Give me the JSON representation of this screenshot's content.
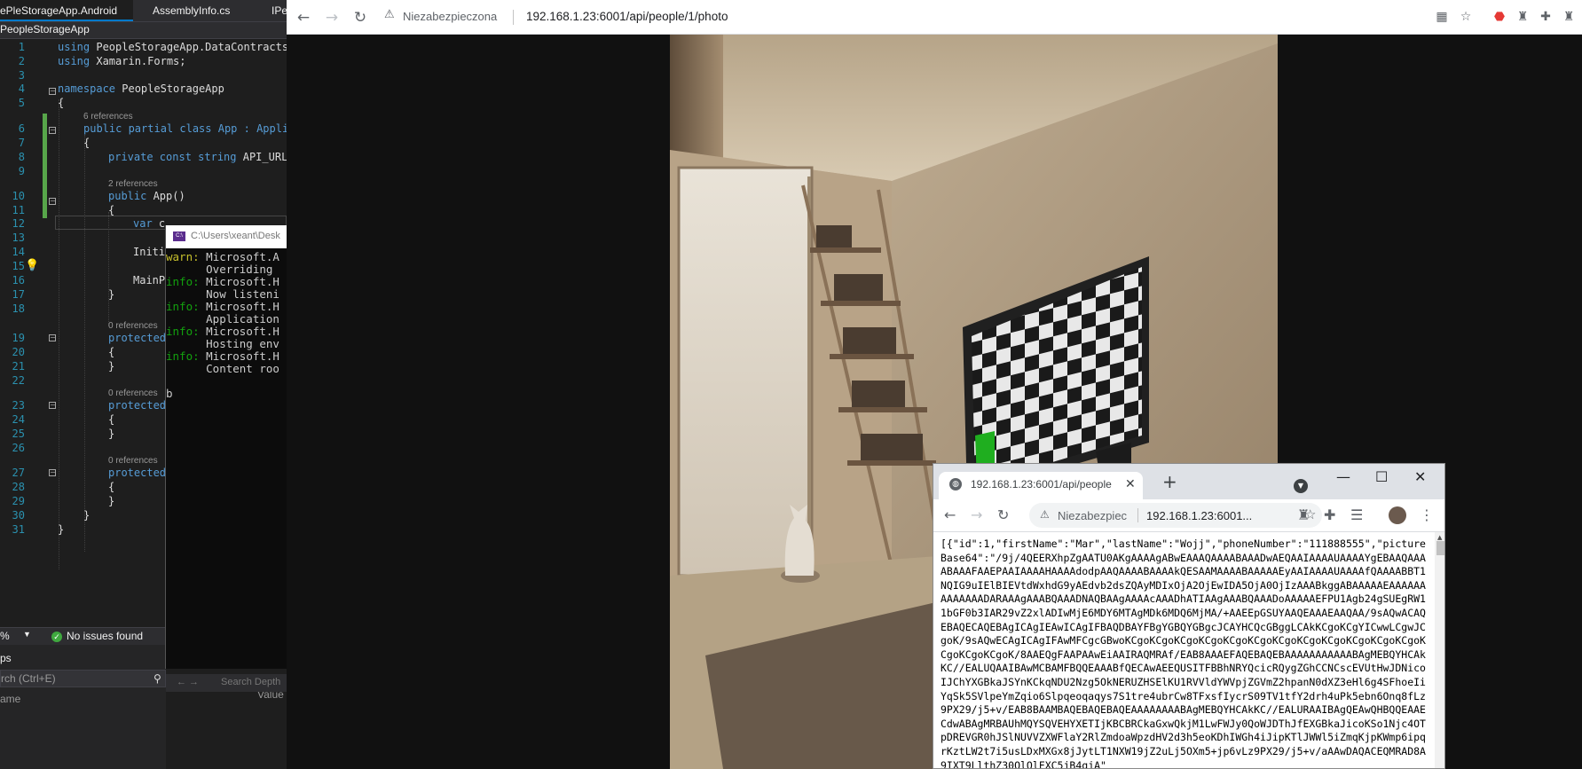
{
  "vs": {
    "tabs": [
      "ePleStorageApp.Android",
      "AssemblyInfo.cs",
      "IPe"
    ],
    "breadcrumb": "PeopleStorageApp",
    "line_numbers": [
      "1",
      "2",
      "3",
      "4",
      "5",
      "6",
      "7",
      "8",
      "9",
      "10",
      "11",
      "12",
      "13",
      "14",
      "15",
      "16",
      "17",
      "18",
      "19",
      "20",
      "21",
      "22",
      "23",
      "24",
      "25",
      "26",
      "27",
      "28",
      "29",
      "30",
      "31"
    ],
    "code": {
      "l1_kw": "using",
      "l1_rest": " PeopleStorageApp.DataContracts;",
      "l2_kw": "using",
      "l2_rest": " Xamarin.Forms;",
      "l4_kw": "namespace",
      "l4_rest": " PeopleStorageApp",
      "l5": "{",
      "refs6": "6 references",
      "l6": "public partial class App : Applic",
      "l7": "{",
      "l8_kw": "private const string",
      "l8_rest": " API_URL",
      "refs10": "2 references",
      "l10_kw": "public",
      "l10_rest": " App()",
      "l11": "{",
      "l12_kw": "var",
      "l12_rest": " c",
      "l14": "Initi",
      "l16": "MainP",
      "l17": "}",
      "refs19": "0 references",
      "l19": "protected",
      "l20": "{",
      "l21": "}",
      "refs23": "0 references",
      "l23": "protected",
      "l24": "{",
      "l25": "}",
      "refs27": "0 references",
      "l27": "protected",
      "l28": "{",
      "l29": "}",
      "l30": "}",
      "l31": "}"
    },
    "status": {
      "zoom": "%",
      "issues": "No issues found"
    },
    "bottom_panel": {
      "title": "ps",
      "search_placeholder": "rch (Ctrl+E)",
      "col_name": "ame",
      "col_value": "Value"
    }
  },
  "console": {
    "title": "C:\\Users\\xeant\\Desk",
    "lines": [
      {
        "level": "warn:",
        "text": " Microsoft.A"
      },
      {
        "level": "",
        "text": "      Overriding"
      },
      {
        "level": "info:",
        "text": " Microsoft.H"
      },
      {
        "level": "",
        "text": "      Now listeni"
      },
      {
        "level": "info:",
        "text": " Microsoft.H"
      },
      {
        "level": "",
        "text": "      Application"
      },
      {
        "level": "info:",
        "text": " Microsoft.H"
      },
      {
        "level": "",
        "text": "      Hosting env"
      },
      {
        "level": "info:",
        "text": " Microsoft.H"
      },
      {
        "level": "",
        "text": "      Content roo"
      }
    ],
    "cursor": "b",
    "footer": "Search Depth"
  },
  "browser": {
    "security_label": "Niezabezpieczona",
    "url": "192.168.1.23:6001/api/people/1/photo"
  },
  "browser2": {
    "tab_title": "192.168.1.23:6001/api/people",
    "security_label": "Niezabezpiec",
    "url": "192.168.1.23:6001...",
    "json_body": "[{\"id\":1,\"firstName\":\"Mar\",\"lastName\":\"Wojj\",\"phoneNumber\":\"111888555\",\"pictureBase64\":\"/9j/4QEERXhpZgAATU0AKgAAAAgABwEAAAQAAAABAAADwAEQAAIAAAAUAAAAYgEBAAQAAAABAAAFAAEPAAIAAAAHAAAAdodpAAQAAAABAAAAkQESAAMAAAABAAAAAEyAAIAAAAUAAAAfQAAAABBT1NQIG9uIElBIEVtdWxhdG9yAEdvb2dsZQAyMDIxOjA2OjEwIDA5OjA0OjIzAAABkggABAAAAAEAAAAAAAAAAAAADARAAAgAAABQAAADNAQBAAgAAAAcAAADhATIAAgAAABQAAADoAAAAAEFPU1Agb24gSUEgRW11bGF0b3IAR29vZ2xlADIwMjE6MDY6MTAgMDk6MDQ6MjMA/+AAEEpGSUYAAQEAAAEAAQAA/9sAQwACAQEBAQECAQEBAgICAgIEAwICAgIFBAQDBAYFBgYGBQYGBgcJCAYHCQcGBggLCAkKCgoKCgYICwwLCgwJCgoK/9sAQwECAgICAgIFAwMFCgcGBwoKCgoKCgoKCgoKCgoKCgoKCgoKCgoKCgoKCgoKCgoKCgoKCgoKCgoKCgoKCgoK/8AAEQgFAAPAAwEiAAIRAQMRAf/EAB8AAAEFAQEBAQEBAAAAAAAAAAABAgMEBQYHCAkKC//EALUQAAIBAwMCBAMFBQQEAAABfQECAwAEEQUSITFBBhNRYQcicRQygZGhCCNCscEVUtHwJDNicoIJChYXGBkaJSYnKCkqNDU2Nzg5OkNERUZHSElKU1RVVldYWVpjZGVmZ2hpanN0dXZ3eHl6g4SFhoeIiYqSk5SVlpeYmZqio6Slpqeoqaqys7S1tre4ubrCw8TFxsfIycrS09TV1tfY2drh4uPk5ebn6Onq8fLz9PX29/j5+v/EAB8BAAMBAQEBAQEBAQEAAAAAAAABAgMEBQYHCAkKC//EALURAAIBAgQEAwQHBQQEAAECdwABAgMRBAUhMQYSQVEHYXETIjKBCBRCkaGxwQkjM1LwFWJy0QoWJDThJfEXGBkaJicoKSo1Njc4OTpDREVGR0hJSlNUVVZXWFlaY2RlZmdoaWpzdHV2d3h5eoKDhIWGh4iJipKTlJWWl5iZmqKjpKWmp6ipqrKztLW2t7i5usLDxMXGx8jJytLT1NXW19jZ2uLj5OXm5+jp6vLz9PX29/j5+v/aAAwDAQACEQMRAD8A9IXT9LlthZ30QlQlFXC5jB4qjA\""
  }
}
